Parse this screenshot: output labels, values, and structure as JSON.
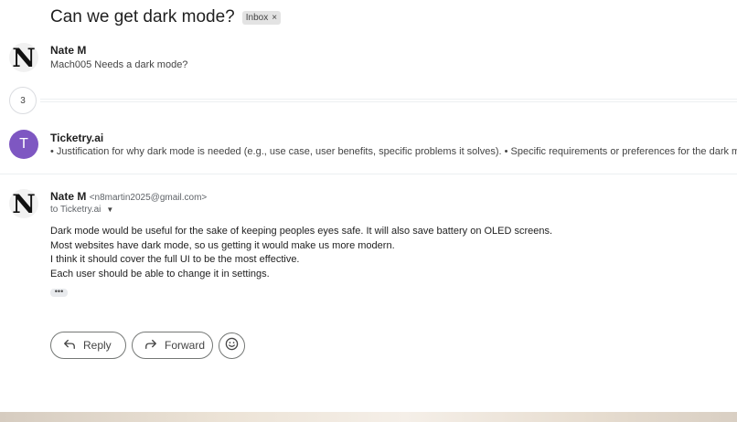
{
  "thread": {
    "subject": "Can we get dark mode?",
    "label": "Inbox",
    "label_remove": "×"
  },
  "messages": [
    {
      "sender": "Nate M",
      "avatar_glyph": "N",
      "snippet": "Mach005 Needs a dark mode?"
    },
    {
      "sender": "Ticketry.ai",
      "avatar_glyph": "T",
      "snippet": "• Justification for why dark mode is needed (e.g., use case, user benefits, specific problems it solves). • Specific requirements or preferences for the dark mo"
    }
  ],
  "collapsed": {
    "count": "3"
  },
  "open_message": {
    "sender": "Nate M",
    "avatar_glyph": "N",
    "email": "<n8martin2025@gmail.com>",
    "to": "to Ticketry.ai",
    "body": [
      "Dark mode would be useful for the sake of keeping peoples eyes safe. It will also save battery on OLED screens.",
      "Most websites have dark mode, so us getting it would make us more modern.",
      "I think it should cover the full UI to be the most effective.",
      "Each user should be able to change it in settings."
    ],
    "trimmed": "•••"
  },
  "actions": {
    "reply": "Reply",
    "forward": "Forward"
  },
  "colors": {
    "ticketry_avatar": "#7e57c2",
    "chip_bg": "#e3e3e3"
  },
  "icons": {
    "reply": "reply-arrow-icon",
    "forward": "forward-arrow-icon",
    "emoji": "smiley-icon",
    "caret": "caret-down-icon"
  }
}
